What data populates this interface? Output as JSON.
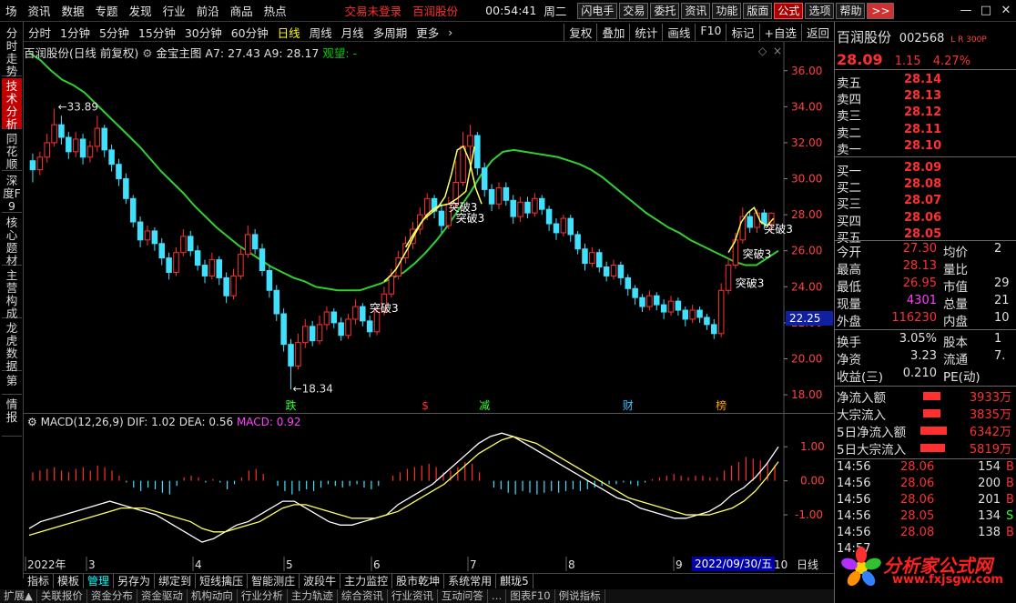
{
  "menu": {
    "items": [
      "场",
      "资讯",
      "数据",
      "专题",
      "发现",
      "行业",
      "前沿",
      "商品",
      "热点"
    ],
    "status_red": [
      "交易未登录",
      "百润股份"
    ],
    "time": "00:54:41",
    "weekday": "周二",
    "buttons": [
      "闪电手",
      "交易",
      "委托",
      "资讯",
      "功能",
      "版面",
      "公式",
      "选项",
      "帮助"
    ],
    "more": ">>"
  },
  "left_tabs": [
    "分时走势",
    "技术分析",
    "同花顺",
    "深度F9",
    "核心题材",
    "主营构成",
    "龙虎数据",
    "第",
    "情报"
  ],
  "periods": [
    "分时",
    "1分钟",
    "5分钟",
    "15分钟",
    "30分钟",
    "60分钟",
    "日线",
    "周线",
    "月线",
    "多周期",
    "更多"
  ],
  "period_selected": "日线",
  "toolbar_right": [
    "复权",
    "叠加",
    "统计",
    "画线",
    "F10",
    "标记",
    "+自选",
    "返回"
  ],
  "chart_info": {
    "title": "百润股份(日线 前复权)",
    "indicator": "金宝主图",
    "a7": "A7: 27.43",
    "a9": "A9: 28.17",
    "signal": "观望: -"
  },
  "chart_data": {
    "type": "candlestick",
    "y_ticks": [
      18.0,
      20.0,
      22.0,
      24.0,
      26.0,
      28.0,
      30.0,
      32.0,
      34.0,
      36.0
    ],
    "ylim": [
      17.6,
      37.2
    ],
    "current_price_marker": "22.25",
    "high_annotation": "33.89",
    "low_annotation": "18.34",
    "signal_labels": [
      "突破3",
      "突破3",
      "突破3",
      "突破3",
      "突破3",
      "突破3"
    ],
    "event_labels": [
      {
        "text": "跌",
        "color": "#30ff30"
      },
      {
        "text": "$",
        "color": "#ff3030"
      },
      {
        "text": "减",
        "color": "#30ff30"
      },
      {
        "text": "财",
        "color": "#40c0ff"
      },
      {
        "text": "榜",
        "color": "#ffa000"
      }
    ],
    "x_labels": [
      "2022年",
      "3",
      "4",
      "5",
      "6",
      "7",
      "8",
      "9",
      "10"
    ],
    "x_highlight": "2022/09/30/五",
    "period_label": "日线",
    "ma_series": [
      37.0,
      36.6,
      36.0,
      35.5,
      35.2,
      34.8,
      34.2,
      33.6,
      33.0,
      32.4,
      31.8,
      31.1,
      30.4,
      29.8,
      29.2,
      28.5,
      27.9,
      27.3,
      26.8,
      26.3,
      25.9,
      25.5,
      25.1,
      24.8,
      24.5,
      24.3,
      24.0,
      23.9,
      23.8,
      23.8,
      23.8,
      24.0,
      24.2,
      24.5,
      24.8,
      25.3,
      25.9,
      26.6,
      27.4,
      28.3,
      29.2,
      30.2,
      31.0,
      31.5,
      31.6,
      31.5,
      31.4,
      31.3,
      31.2,
      31.0,
      30.8,
      30.5,
      30.1,
      29.6,
      29.1,
      28.6,
      28.1,
      27.7,
      27.3,
      27.0,
      26.6,
      26.3,
      26.0,
      25.7,
      25.4,
      25.2,
      25.2,
      25.6,
      26.0
    ],
    "yellow_series": [
      24.3,
      24.6,
      25.0,
      25.6,
      26.2,
      26.9,
      27.5,
      28.0,
      28.3,
      28.5,
      29.0,
      30.2,
      31.6,
      31.8,
      31.0,
      29.5,
      28.6
    ],
    "yellow_series2": [
      26.2,
      27.0,
      27.7,
      28.1,
      28.5,
      28.6,
      28.9,
      29.3,
      31.8
    ],
    "yellow_series3": [
      25.9,
      26.5,
      27.6,
      28.1,
      28.4,
      27.6,
      27.4,
      27.8
    ],
    "candles": [
      [
        31.0,
        30.5,
        31.4,
        29.8
      ],
      [
        30.5,
        31.2,
        31.5,
        30.2
      ],
      [
        31.2,
        32.0,
        32.5,
        30.9
      ],
      [
        32.0,
        33.0,
        33.9,
        31.8
      ],
      [
        33.0,
        32.3,
        33.5,
        31.9
      ],
      [
        32.3,
        31.5,
        32.6,
        31.1
      ],
      [
        31.5,
        32.2,
        32.6,
        31.2
      ],
      [
        32.2,
        31.2,
        32.5,
        30.8
      ],
      [
        31.2,
        31.8,
        32.1,
        30.9
      ],
      [
        31.8,
        32.8,
        33.5,
        31.5
      ],
      [
        32.8,
        31.6,
        33.0,
        31.2
      ],
      [
        31.6,
        30.8,
        31.9,
        30.4
      ],
      [
        30.8,
        30.0,
        31.1,
        29.6
      ],
      [
        30.0,
        28.9,
        30.3,
        28.6
      ],
      [
        28.9,
        27.6,
        29.1,
        27.3
      ],
      [
        27.6,
        26.6,
        27.9,
        26.2
      ],
      [
        26.6,
        27.1,
        27.4,
        26.3
      ],
      [
        27.1,
        26.4,
        27.3,
        26.0
      ],
      [
        26.4,
        25.6,
        26.7,
        25.2
      ],
      [
        25.6,
        24.8,
        25.9,
        24.4
      ],
      [
        24.8,
        25.9,
        26.2,
        24.6
      ],
      [
        25.9,
        26.8,
        27.2,
        25.7
      ],
      [
        26.8,
        26.0,
        27.1,
        25.7
      ],
      [
        26.0,
        25.2,
        26.3,
        24.9
      ],
      [
        25.2,
        24.6,
        25.5,
        24.2
      ],
      [
        24.6,
        25.5,
        25.9,
        24.4
      ],
      [
        25.5,
        24.5,
        25.7,
        24.1
      ],
      [
        24.5,
        23.5,
        24.8,
        23.1
      ],
      [
        23.5,
        24.6,
        25.0,
        23.3
      ],
      [
        24.6,
        25.8,
        26.2,
        24.4
      ],
      [
        25.8,
        26.9,
        27.4,
        25.6
      ],
      [
        26.9,
        26.1,
        27.2,
        25.8
      ],
      [
        26.1,
        24.9,
        26.4,
        24.6
      ],
      [
        24.9,
        23.8,
        25.2,
        23.4
      ],
      [
        23.8,
        22.5,
        24.1,
        22.1
      ],
      [
        22.5,
        20.8,
        22.8,
        20.4
      ],
      [
        20.8,
        19.6,
        21.1,
        18.3
      ],
      [
        19.6,
        20.9,
        21.4,
        19.4
      ],
      [
        20.9,
        21.8,
        22.2,
        20.6
      ],
      [
        21.8,
        21.0,
        22.1,
        20.7
      ],
      [
        21.0,
        21.9,
        22.4,
        20.8
      ],
      [
        21.9,
        22.6,
        22.9,
        21.6
      ],
      [
        22.6,
        22.0,
        22.8,
        21.7
      ],
      [
        22.0,
        21.3,
        22.3,
        21.0
      ],
      [
        21.3,
        22.2,
        22.5,
        21.1
      ],
      [
        22.2,
        22.9,
        23.3,
        21.9
      ],
      [
        22.9,
        22.1,
        23.1,
        21.8
      ],
      [
        22.1,
        21.5,
        22.4,
        21.2
      ],
      [
        21.5,
        22.6,
        22.9,
        21.3
      ],
      [
        22.6,
        23.6,
        24.0,
        22.4
      ],
      [
        23.6,
        24.6,
        25.0,
        23.4
      ],
      [
        24.6,
        25.6,
        26.0,
        24.4
      ],
      [
        25.6,
        26.4,
        26.8,
        25.3
      ],
      [
        26.4,
        27.2,
        27.6,
        26.1
      ],
      [
        27.2,
        28.0,
        28.4,
        26.9
      ],
      [
        28.0,
        28.9,
        29.2,
        27.7
      ],
      [
        28.9,
        28.2,
        29.1,
        27.8
      ],
      [
        28.2,
        27.4,
        28.6,
        27.0
      ],
      [
        27.4,
        28.6,
        29.0,
        27.2
      ],
      [
        28.6,
        29.8,
        31.0,
        28.4
      ],
      [
        29.8,
        31.8,
        32.6,
        29.6
      ],
      [
        31.8,
        32.4,
        33.0,
        31.0
      ],
      [
        32.4,
        30.6,
        32.6,
        30.2
      ],
      [
        30.6,
        29.4,
        30.9,
        29.0
      ],
      [
        29.4,
        28.6,
        29.7,
        28.2
      ],
      [
        28.6,
        29.5,
        29.8,
        28.3
      ],
      [
        29.5,
        28.8,
        29.8,
        28.5
      ],
      [
        28.8,
        27.9,
        29.1,
        27.5
      ],
      [
        27.9,
        28.7,
        29.0,
        27.6
      ],
      [
        28.7,
        28.1,
        29.0,
        27.8
      ],
      [
        28.1,
        28.9,
        29.2,
        27.9
      ],
      [
        28.9,
        28.3,
        29.1,
        28.0
      ],
      [
        28.3,
        27.5,
        28.5,
        27.1
      ],
      [
        27.5,
        27.0,
        27.8,
        26.6
      ],
      [
        27.0,
        27.8,
        28.0,
        26.8
      ],
      [
        27.8,
        26.9,
        28.0,
        26.5
      ],
      [
        26.9,
        26.1,
        27.1,
        25.8
      ],
      [
        26.1,
        25.3,
        26.4,
        24.9
      ],
      [
        25.3,
        25.9,
        26.2,
        25.1
      ],
      [
        25.9,
        25.1,
        26.1,
        24.8
      ],
      [
        25.1,
        24.6,
        25.4,
        24.3
      ],
      [
        24.6,
        25.2,
        25.5,
        24.4
      ],
      [
        25.2,
        24.5,
        25.4,
        24.1
      ],
      [
        24.5,
        23.9,
        24.7,
        23.5
      ],
      [
        23.9,
        23.4,
        24.1,
        23.0
      ],
      [
        23.4,
        22.9,
        23.6,
        22.6
      ],
      [
        22.9,
        23.5,
        23.8,
        22.7
      ],
      [
        23.5,
        23.0,
        23.7,
        22.7
      ],
      [
        23.0,
        22.6,
        23.3,
        22.2
      ],
      [
        22.6,
        23.2,
        23.5,
        22.4
      ],
      [
        23.2,
        22.7,
        23.4,
        22.4
      ],
      [
        22.7,
        22.2,
        22.9,
        21.8
      ],
      [
        22.2,
        22.7,
        23.0,
        22.0
      ],
      [
        22.7,
        22.3,
        22.9,
        22.0
      ],
      [
        22.3,
        21.9,
        22.5,
        21.6
      ],
      [
        21.9,
        21.4,
        22.2,
        21.1
      ],
      [
        21.4,
        23.8,
        24.2,
        21.2
      ],
      [
        23.8,
        25.2,
        25.6,
        23.6
      ],
      [
        25.2,
        26.6,
        27.0,
        25.0
      ],
      [
        26.6,
        27.9,
        28.4,
        26.4
      ],
      [
        27.9,
        27.3,
        28.2,
        27.0
      ],
      [
        27.3,
        28.1,
        28.3,
        27.0
      ],
      [
        28.1,
        27.5,
        28.3,
        27.2
      ],
      [
        27.5,
        28.09,
        28.13,
        26.95
      ]
    ]
  },
  "macd": {
    "name": "MACD(12,26,9)",
    "dif": "DIF: 1.02",
    "dea": "DEA: 0.56",
    "macd": "MACD: 0.92",
    "y_ticks": [
      "1.00",
      "0.00",
      "-1.00"
    ],
    "ylim": [
      -2.2,
      1.7
    ],
    "hist": [
      0.5,
      0.6,
      0.7,
      0.8,
      0.6,
      0.5,
      0.7,
      0.8,
      0.6,
      0.9,
      0.8,
      0.6,
      0.3,
      -0.1,
      -0.4,
      -0.6,
      -0.4,
      -0.5,
      -0.7,
      -0.8,
      -0.3,
      0.2,
      0.3,
      0.2,
      -0.1,
      0.1,
      -0.1,
      -0.5,
      -0.2,
      0.2,
      0.6,
      0.7,
      0.4,
      0.0,
      -0.3,
      -0.6,
      -0.8,
      -0.6,
      -0.5,
      -0.6,
      -0.4,
      -0.2,
      -0.3,
      -0.4,
      -0.3,
      -0.2,
      -0.4,
      -0.5,
      -0.3,
      0.0,
      0.3,
      0.5,
      0.7,
      0.8,
      0.9,
      1.0,
      0.8,
      0.5,
      0.6,
      0.8,
      1.1,
      1.0,
      0.5,
      0.0,
      -0.4,
      -0.5,
      -0.7,
      -0.8,
      -0.6,
      -0.7,
      -0.8,
      -0.7,
      -0.6,
      -0.7,
      -0.6,
      -0.5,
      -0.6,
      -0.5,
      -0.4,
      -0.3,
      -0.2,
      -0.2,
      -0.1,
      -0.2,
      -0.3,
      -0.1,
      0.1,
      0.2,
      0.3,
      0.4,
      0.3,
      0.2,
      0.3,
      0.3,
      0.2,
      0.2,
      0.6,
      0.9,
      1.1,
      1.4,
      1.3,
      1.2,
      1.1,
      0.92
    ],
    "dif_series": [
      -1.4,
      -1.2,
      -1.1,
      -1.0,
      -0.9,
      -0.8,
      -0.7,
      -0.6,
      -0.7,
      -0.8,
      -0.9,
      -1.0,
      -1.2,
      -1.4,
      -1.6,
      -1.8,
      -1.7,
      -1.5,
      -1.3,
      -1.2,
      -1.0,
      -0.8,
      -0.6,
      -0.6,
      -0.8,
      -1.0,
      -1.2,
      -1.3,
      -1.3,
      -1.2,
      -1.1,
      -1.0,
      -0.7,
      -0.5,
      -0.3,
      -0.1,
      0.2,
      0.5,
      0.8,
      1.1,
      1.3,
      1.4,
      1.3,
      1.1,
      0.9,
      0.7,
      0.5,
      0.3,
      0.1,
      -0.1,
      -0.3,
      -0.5,
      -0.6,
      -0.8,
      -0.9,
      -1.0,
      -1.1,
      -1.1,
      -1.0,
      -0.9,
      -0.7,
      -0.4,
      -0.2,
      0.1,
      0.5,
      1.0
    ],
    "dea_series": [
      -1.6,
      -1.5,
      -1.4,
      -1.3,
      -1.2,
      -1.1,
      -1.0,
      -0.9,
      -0.8,
      -0.8,
      -0.8,
      -0.9,
      -1.0,
      -1.1,
      -1.2,
      -1.4,
      -1.5,
      -1.5,
      -1.4,
      -1.3,
      -1.2,
      -1.0,
      -0.8,
      -0.7,
      -0.7,
      -0.8,
      -0.9,
      -1.0,
      -1.1,
      -1.1,
      -1.1,
      -1.0,
      -0.9,
      -0.7,
      -0.5,
      -0.3,
      -0.1,
      0.2,
      0.5,
      0.8,
      1.0,
      1.2,
      1.3,
      1.2,
      1.1,
      0.9,
      0.7,
      0.5,
      0.3,
      0.1,
      -0.1,
      -0.3,
      -0.5,
      -0.6,
      -0.7,
      -0.8,
      -0.9,
      -1.0,
      -1.0,
      -1.0,
      -0.9,
      -0.8,
      -0.6,
      -0.3,
      0.1,
      0.56
    ]
  },
  "bottom_tabs": [
    "指标",
    "模板",
    "管理",
    "另存为",
    "绑定到",
    "短线擒压",
    "智能测庄",
    "波段牛",
    "主力监控",
    "股市乾坤",
    "系统常用",
    "麒珑5"
  ],
  "bottom_tab_selected": "管理",
  "bottom_tabs2": [
    "扩展▲",
    "关联报价",
    "资金分布",
    "资金驱动",
    "机构动向",
    "行业分析",
    "主力轨迹",
    "综合资讯",
    "行业资讯",
    "互动问答",
    "…",
    "图表F10",
    "例说指标"
  ],
  "stock": {
    "name": "百润股份",
    "code": "002568",
    "tag": "L R 300P",
    "price": "28.09",
    "change": "1.15",
    "pct": "4.27%"
  },
  "orderbook": [
    {
      "label": "卖五",
      "value": "28.14"
    },
    {
      "label": "卖四",
      "value": "28.13"
    },
    {
      "label": "卖三",
      "value": "28.12"
    },
    {
      "label": "卖二",
      "value": "28.11"
    },
    {
      "label": "卖一",
      "value": "28.10"
    },
    {
      "label": "买一",
      "value": "28.09"
    },
    {
      "label": "买二",
      "value": "28.08"
    },
    {
      "label": "买三",
      "value": "28.07"
    },
    {
      "label": "买四",
      "value": "28.06"
    },
    {
      "label": "买五",
      "value": "28.05"
    }
  ],
  "stats": [
    {
      "l1": "今开",
      "v1": "27.30",
      "l2": "均价",
      "v2": "2"
    },
    {
      "l1": "最高",
      "v1": "28.13",
      "l2": "量比",
      "v2": ""
    },
    {
      "l1": "最低",
      "v1": "26.95",
      "l2": "市值",
      "v2": "29"
    },
    {
      "l1": "现量",
      "v1": "4301",
      "l2": "总量",
      "v2": "21"
    },
    {
      "l1": "外盘",
      "v1": "116230",
      "l2": "内盘",
      "v2": "10"
    },
    {
      "l1": "换手",
      "v1": "3.05%",
      "l2": "股本",
      "v2": "1"
    },
    {
      "l1": "净资",
      "v1": "3.23",
      "l2": "流通",
      "v2": "7."
    },
    {
      "l1": "收益(三)",
      "v1": "0.210",
      "l2": "PE(动)",
      "v2": ""
    }
  ],
  "flows": [
    {
      "label": "净流入额",
      "value": "3933万",
      "ratio": 0.55
    },
    {
      "label": "大宗流入",
      "value": "3835万",
      "ratio": 0.55
    },
    {
      "label": "5日净流入额",
      "value": "6342万",
      "ratio": 0.85
    },
    {
      "label": "5日大宗流入",
      "value": "5819万",
      "ratio": 0.8
    }
  ],
  "ticks": [
    {
      "time": "14:56",
      "price": "28.06",
      "vol": "154",
      "dir": "B"
    },
    {
      "time": "14:56",
      "price": "28.06",
      "vol": "200",
      "dir": "B"
    },
    {
      "time": "14:56",
      "price": "28.06",
      "vol": "201",
      "dir": "B"
    },
    {
      "time": "14:56",
      "price": "28.05",
      "vol": "134",
      "dir": "S"
    },
    {
      "time": "14:56",
      "price": "28.08",
      "vol": "138",
      "dir": "B"
    },
    {
      "time": "14:57",
      "price": "",
      "vol": "",
      "dir": ""
    }
  ],
  "logo": {
    "text": "分析家公式网",
    "url": "www.fxjsgw.com"
  },
  "colors": {
    "up": "#ff3030",
    "down": "#40e0ff",
    "ma": "#30d030",
    "yellow": "#ffff60",
    "bg": "#000000"
  }
}
